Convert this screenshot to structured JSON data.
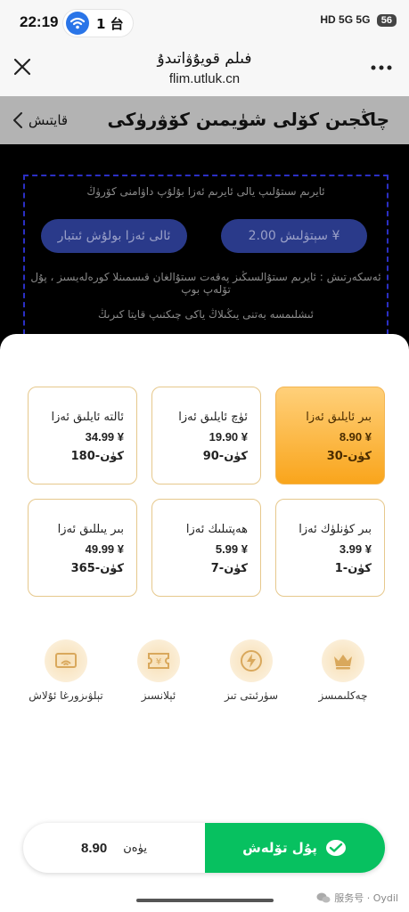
{
  "status_bar": {
    "time": "22:19",
    "pill_text": "1 台",
    "right_indicators": "HD 5G 5G",
    "battery": "56"
  },
  "browser": {
    "heading": "فىلم قويۇۋاتىدۇ",
    "url": "flim.utluk.cn"
  },
  "nav": {
    "back_label": "قايتىش",
    "title": "چاڭجىن كۆلى شۈيمىن كۆۋرۈكى"
  },
  "notice": {
    "text": "ئايرىم سىتۇلىپ يالى ئايرىم ئەزا بۇلۇپ داۋامنى كۆرۈڭ",
    "price_button": "سېتۋلىش 2.00 ¥",
    "share_button": "ئالى ئەزا بولۇش ئىتبار",
    "line1": "ئەسكەرتىش : ئايرىم سىتۇالسىڭىز پەقەت سىتۇالغان قىسمىنلا كورەلەيسىز ، پۇل تۆلەپ بوپ",
    "line2": "ئىشلىمسە بەتنى يىڭىلاڭ ياكى چىكنىپ قايتا كىرىڭ"
  },
  "plans": [
    {
      "name": "بىر ئايلىق ئەزا",
      "price": "8.90 ¥",
      "duration": "30-كۈن",
      "selected": true
    },
    {
      "name": "ئۈچ ئايلىق ئەزا",
      "price": "19.90 ¥",
      "duration": "90-كۈن",
      "selected": false
    },
    {
      "name": "ئالتە ئايلىق ئەزا",
      "price": "34.99 ¥",
      "duration": "180-كۈن",
      "selected": false
    },
    {
      "name": "بىر كۈنلۈك ئەزا",
      "price": "3.99 ¥",
      "duration": "1-كۈن",
      "selected": false
    },
    {
      "name": "ھەپتىلىك ئەزا",
      "price": "5.99 ¥",
      "duration": "7-كۈن",
      "selected": false
    },
    {
      "name": "بىر يىللىق ئەزا",
      "price": "49.99 ¥",
      "duration": "365-كۈن",
      "selected": false
    }
  ],
  "features": [
    {
      "label": "چەكلىمىسز",
      "icon": "crown-icon"
    },
    {
      "label": "سۈرئىتى تىز",
      "icon": "lightning-icon"
    },
    {
      "label": "ئېلانسىز",
      "icon": "ticket-icon"
    },
    {
      "label": "تېلۋىزورغا ئۇلاش",
      "icon": "tv-cast-icon"
    }
  ],
  "footer": {
    "total_label": "يۈەن",
    "total_amount": "8.90",
    "pay_label": "پۇل تۆلەش"
  },
  "watermark": "服务号 · Oydil",
  "colors": {
    "accent_gold": "#f9a51c",
    "pay_green": "#07c160",
    "dark_button": "#2a3a8a"
  }
}
